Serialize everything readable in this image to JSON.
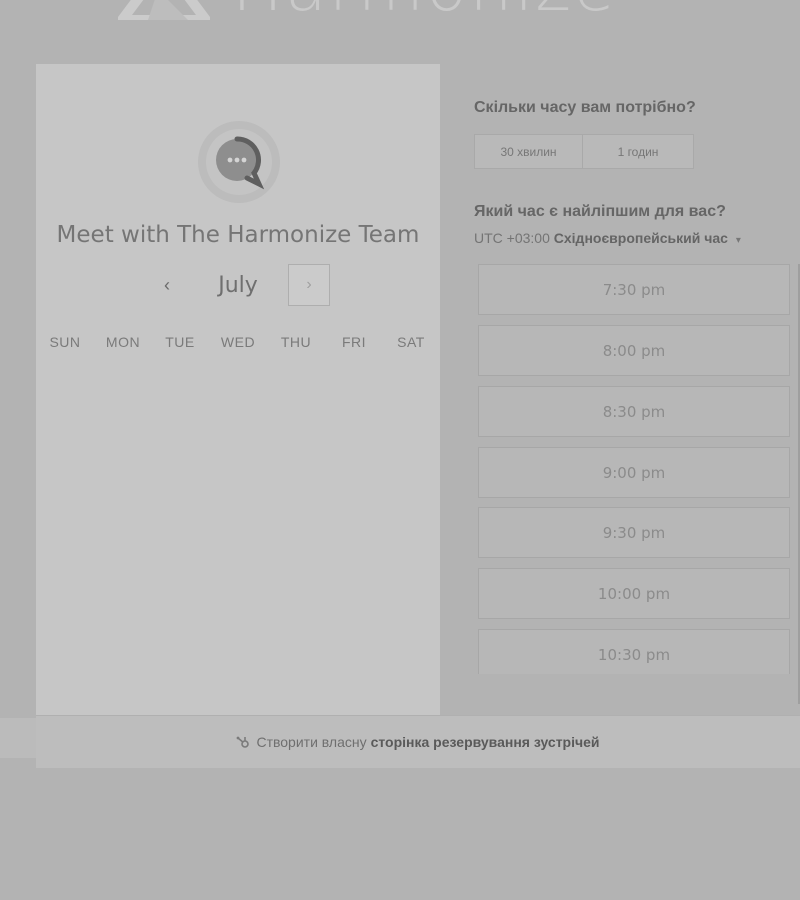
{
  "brand": {
    "wordmark": "Harmonize"
  },
  "card": {
    "avatar_icon": "chat-bubble-icon",
    "title": "Meet with The Harmonize Team",
    "calendar": {
      "prev_icon": "‹",
      "next_icon": "›",
      "month": "July",
      "weekdays": [
        "SUN",
        "MON",
        "TUE",
        "WED",
        "THU",
        "FRI",
        "SAT"
      ]
    }
  },
  "booking": {
    "duration_question": "Скільки часу вам потрібно?",
    "durations": [
      "30 хвилин",
      "1 годин"
    ],
    "time_question": "Який час є найліпшим для вас?",
    "timezone": {
      "offset": "UTC +03:00",
      "name": "Східноєвропейський час",
      "caret": "▾"
    },
    "slots": [
      "7:30 pm",
      "8:00 pm",
      "8:30 pm",
      "9:00 pm",
      "9:30 pm",
      "10:00 pm",
      "10:30 pm"
    ]
  },
  "footer": {
    "icon": "hubspot-sprocket-icon",
    "prefix": "Створити власну",
    "link": "сторінка резервування зустрічей"
  }
}
